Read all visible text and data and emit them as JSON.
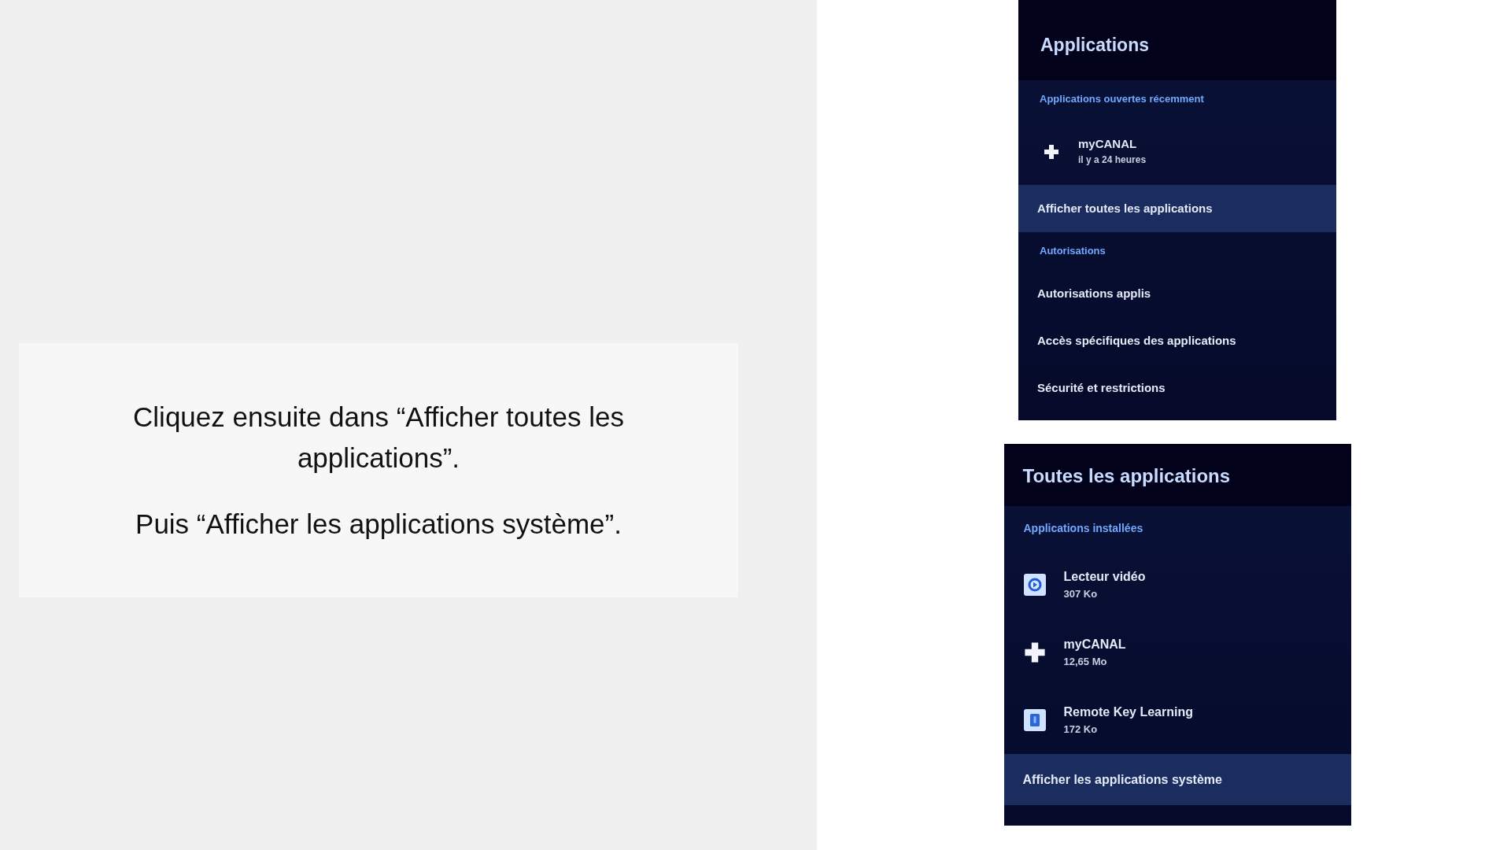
{
  "instruction_card": {
    "paragraphs": [
      "Cliquez ensuite dans “Afficher toutes les applications”.",
      "Puis “Afficher les applications système”."
    ]
  },
  "screens": [
    {
      "title": "Applications",
      "groups": [
        {
          "heading": "Applications ouvertes récemment",
          "items": [
            {
              "kind": "app",
              "name": "myCANAL",
              "detail": "il y a 24 heures",
              "selected": false
            },
            {
              "kind": "link",
              "label": "Afficher toutes les applications",
              "selected": true
            }
          ]
        },
        {
          "heading": "Autorisations",
          "items": [
            {
              "kind": "link",
              "label": "Autorisations applis",
              "selected": false
            },
            {
              "kind": "link",
              "label": "Accès spécifiques des applications",
              "selected": false
            },
            {
              "kind": "link",
              "label": "Sécurité et restrictions",
              "selected": false
            }
          ]
        }
      ]
    },
    {
      "title": "Toutes les applications",
      "groups": [
        {
          "heading": "Applications installées",
          "items": [
            {
              "kind": "app",
              "name": "Lecteur vidéo",
              "detail": "307 Ko",
              "selected": false
            },
            {
              "kind": "app",
              "name": "myCANAL",
              "detail": "12,65 Mo",
              "selected": false
            },
            {
              "kind": "app",
              "name": "Remote Key Learning",
              "detail": "172 Ko",
              "selected": false
            },
            {
              "kind": "link",
              "label": "Afficher les applications système",
              "selected": true
            }
          ]
        }
      ]
    }
  ]
}
